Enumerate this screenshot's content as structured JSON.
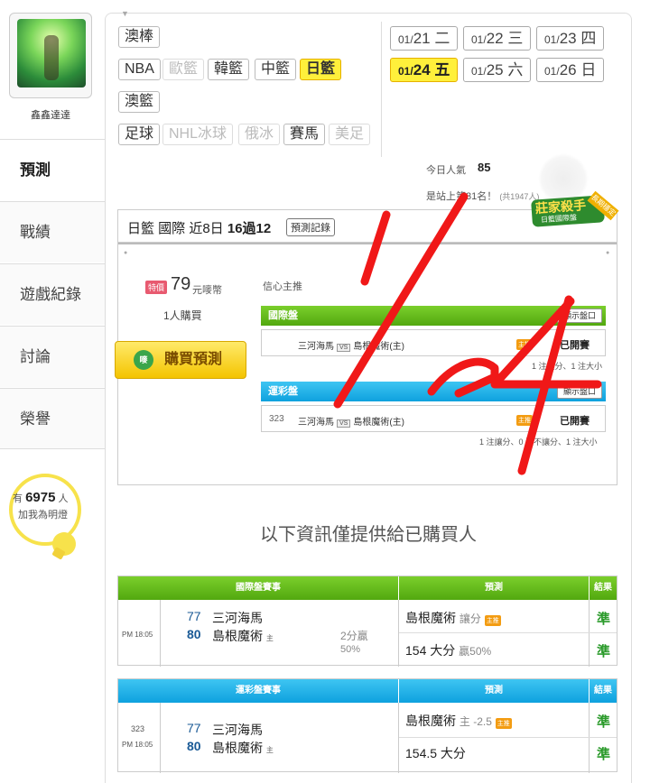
{
  "sidebar": {
    "username": "鑫鑫達達",
    "nav": [
      {
        "label": "預測"
      },
      {
        "label": "戰績"
      },
      {
        "label": "遊戲紀錄"
      },
      {
        "label": "討論"
      },
      {
        "label": "榮譽"
      }
    ],
    "fans": {
      "prefix": "有",
      "count": "6975",
      "suffix": "人",
      "line2": "加我為明燈"
    }
  },
  "sport_tags": {
    "row1": [
      "澳棒"
    ],
    "row2": [
      "NBA",
      "歐籃",
      "韓籃",
      "中籃",
      "日籃"
    ],
    "row3": [
      "澳籃"
    ],
    "row4": [
      "足球",
      "NHL冰球",
      "俄冰",
      "賽馬",
      "美足"
    ]
  },
  "dates": [
    {
      "md": "01/",
      "day": "21",
      "wd": "二"
    },
    {
      "md": "01/",
      "day": "22",
      "wd": "三"
    },
    {
      "md": "01/",
      "day": "23",
      "wd": "四"
    },
    {
      "md": "01/",
      "day": "24",
      "wd": "五"
    },
    {
      "md": "01/",
      "day": "25",
      "wd": "六"
    },
    {
      "md": "01/",
      "day": "26",
      "wd": "日"
    }
  ],
  "popularity": {
    "label": "今日人氣",
    "value": "85",
    "rank_text": "是站上第31名！",
    "rank_note": "(共1947人)"
  },
  "card": {
    "title_prefix": "日籃 國際 近8日",
    "title_record": "16過12",
    "record_button": "預測記錄",
    "badge_title": "莊家殺手",
    "badge_sub": "日籃國際盤",
    "badge_corner": "長期穩定",
    "price_chip": "特價",
    "price": "79",
    "price_unit": "元嘜幣",
    "buyers": "1人購買",
    "buy_button": "購買預測",
    "confidence": "信心主推",
    "intl": {
      "header": "國際盤",
      "show_button": "顯示盤口",
      "away": "三河海馬",
      "vs": "VS",
      "home": "島根魔術(主)",
      "zhu": "主推",
      "status": "已開賽",
      "note": "1 注讓分、1 注大小"
    },
    "lottery": {
      "header": "運彩盤",
      "show_button": "顯示盤口",
      "game_no": "323",
      "away": "三河海馬",
      "vs": "VS",
      "home": "島根魔術(主)",
      "zhu": "主推",
      "status": "已開賽",
      "note": "1 注讓分、0 注不讓分、1 注大小"
    }
  },
  "info_notice": "以下資訊僅提供給已購買人",
  "intl_table": {
    "headers": [
      "國際盤賽事",
      "預測",
      "結果"
    ],
    "time": "PM 18:05",
    "away_score": "77",
    "away_team": "三河海馬",
    "home_score": "80",
    "home_team": "島根魔術",
    "home_mark": "主",
    "spread_result": "2分贏",
    "spread_pct": "50%",
    "pred1_team": "島根魔術",
    "pred1_type": "讓分",
    "pred1_tag": "主推",
    "pred2_value": "154 大分",
    "pred2_note": "贏50%",
    "result1": "準",
    "result2": "準"
  },
  "lottery_table": {
    "headers": [
      "運彩盤賽事",
      "預測",
      "結果"
    ],
    "game_no": "323",
    "time": "PM 18:05",
    "away_score": "77",
    "away_team": "三河海馬",
    "home_score": "80",
    "home_team": "島根魔術",
    "home_mark": "主",
    "pred1_team": "島根魔術",
    "pred1_line": "主 -2.5",
    "pred1_tag": "主推",
    "pred2_value": "154.5 大分",
    "result1": "準",
    "result2": "準"
  },
  "colors": {
    "accent_yellow": "#fff03b",
    "green_header": "#5fb41a",
    "blue_header": "#1aaee6",
    "scribble_red": "#f01818"
  }
}
